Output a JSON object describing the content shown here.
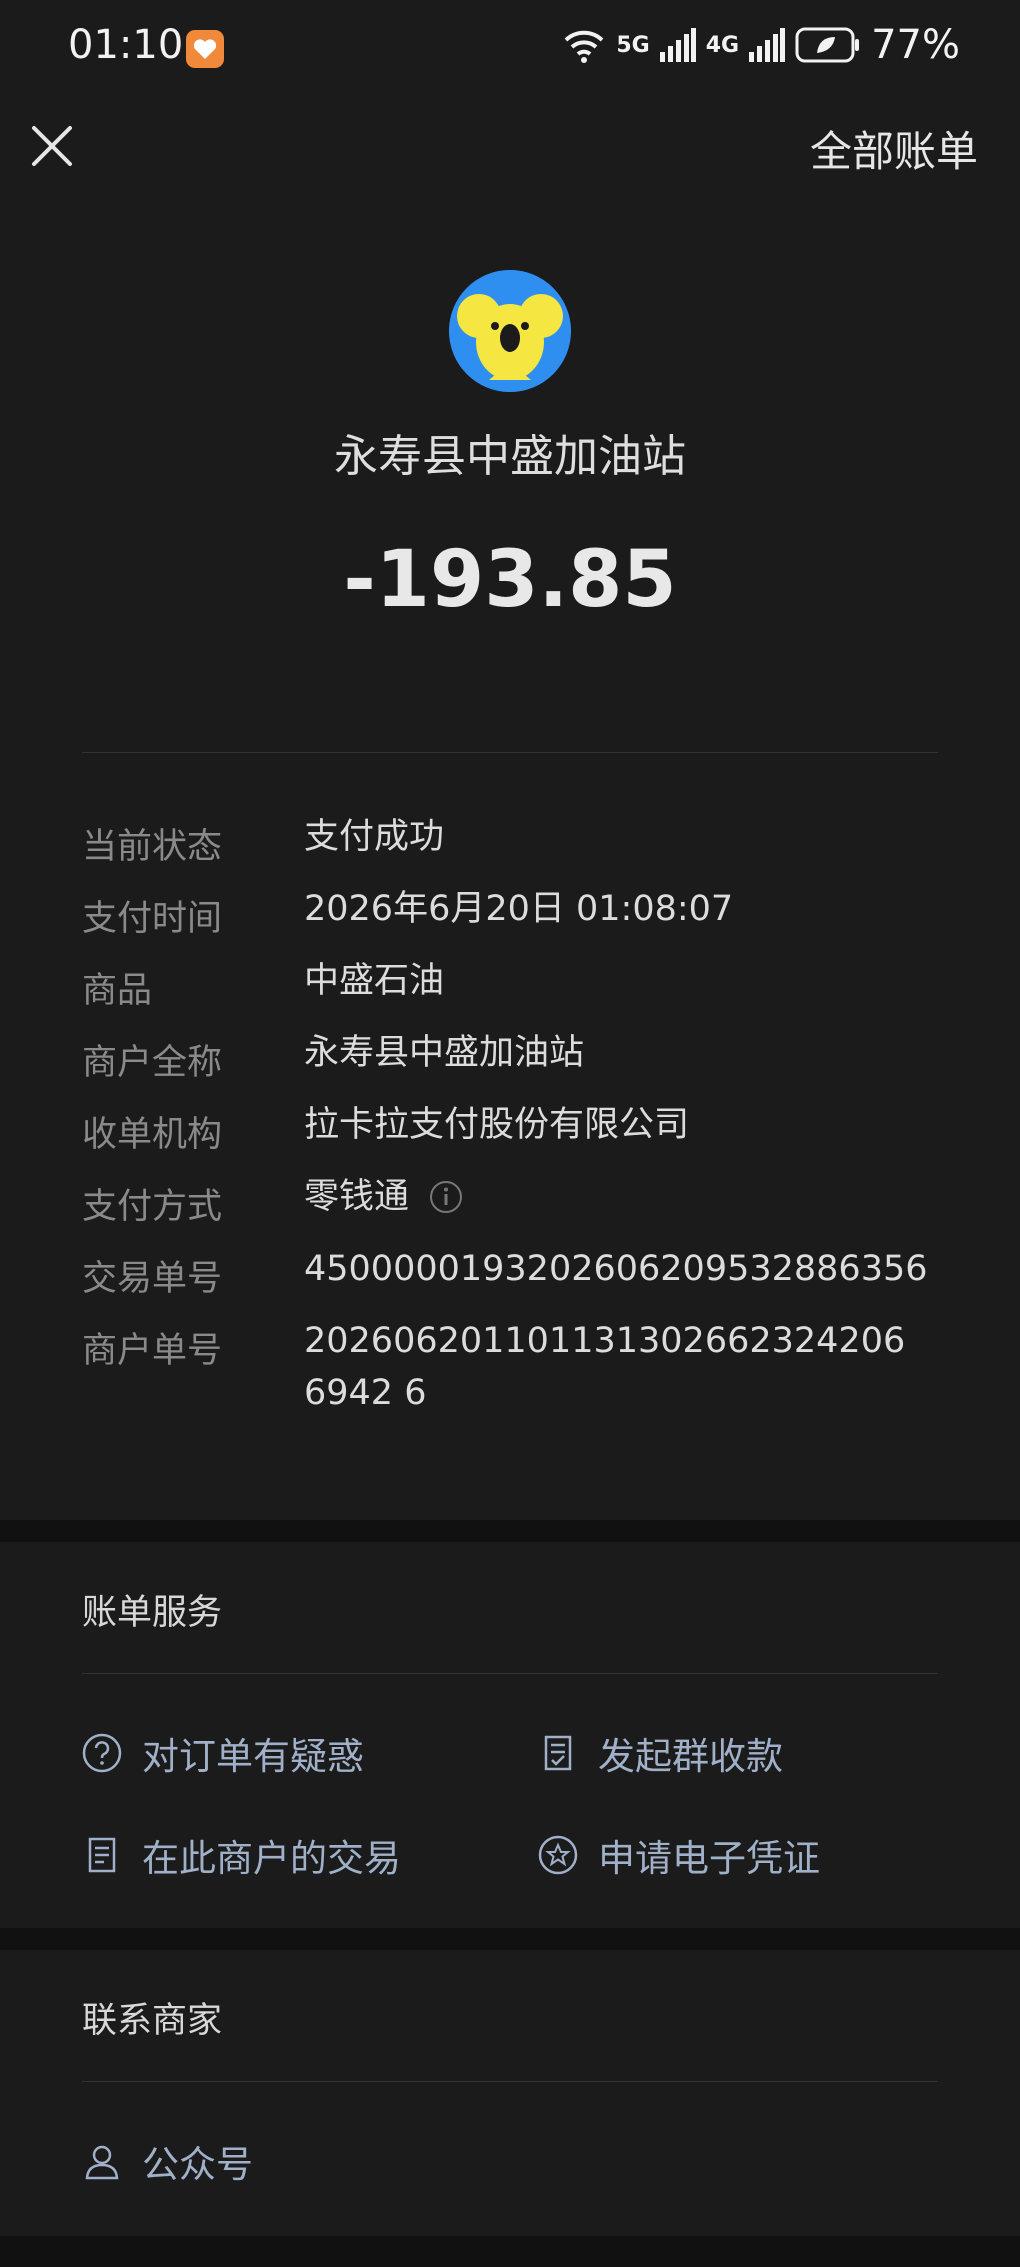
{
  "status": {
    "time": "01:10",
    "network1": "5G",
    "network2": "4G",
    "battery": "77%"
  },
  "nav": {
    "all_bills": "全部账单"
  },
  "merchant": {
    "name": "永寿县中盛加油站",
    "amount": "-193.85"
  },
  "details": [
    {
      "label": "当前状态",
      "value": "支付成功"
    },
    {
      "label": "支付时间",
      "value": "2026年6月20日 01:08:07"
    },
    {
      "label": "商品",
      "value": "中盛石油"
    },
    {
      "label": "商户全称",
      "value": "永寿县中盛加油站"
    },
    {
      "label": "收单机构",
      "value": "拉卡拉支付股份有限公司"
    },
    {
      "label": "支付方式",
      "value": "零钱通"
    },
    {
      "label": "交易单号",
      "value": "4500000193202606209532886356"
    },
    {
      "label": "商户单号",
      "value": "2026062011011313026623242066942 6"
    }
  ],
  "bill_service": {
    "title": "账单服务",
    "items": [
      "对订单有疑惑",
      "发起群收款",
      "在此商户的交易",
      "申请电子凭证"
    ]
  },
  "contact": {
    "title": "联系商家",
    "official_account": "公众号"
  }
}
